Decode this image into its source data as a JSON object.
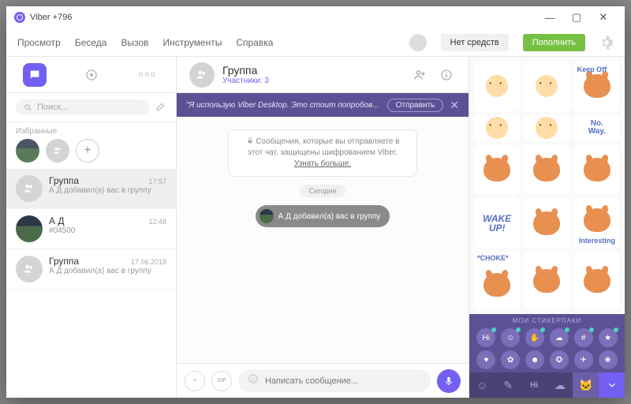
{
  "titlebar": {
    "title": "Viber +796"
  },
  "menubar": {
    "view": "Просмотр",
    "convo": "Беседа",
    "call": "Вызов",
    "tools": "Инструменты",
    "help": "Справка",
    "balance": "Нет средств",
    "topup": "Пополнить"
  },
  "sidebar": {
    "search_placeholder": "Поиск...",
    "favorites_label": "Избранные",
    "chats": [
      {
        "name": "Группа",
        "time": "17:57",
        "snippet": "А Д добавил(а) вас в группу"
      },
      {
        "name": "А Д",
        "time": "12:48",
        "snippet": "#04500"
      },
      {
        "name": "Группа",
        "time": "17.06.2018",
        "snippet": "А Д добавил(а) вас в группу"
      }
    ]
  },
  "chat": {
    "title": "Группа",
    "participants": "Участники: 3",
    "promo_text": "\"Я использую Viber Desktop. Это стоит попробов...",
    "promo_send": "Отправить",
    "encryption_text": "Сообщения, которые вы отправляете в этот чат, защищены шифрованием Viber.",
    "encryption_learn": "Узнать больше.",
    "date_label": "Сегодня",
    "system_msg": "А Д добавил(а) вас в группу",
    "composer_placeholder": "Написать сообщение..."
  },
  "stickers": {
    "captions": {
      "keepoff": "Keep Off",
      "noway": "No. Way.",
      "wake": "WAKE UP!",
      "interesting": "Interesting",
      "choke": "*CHOKE*"
    },
    "packs_title": "МОИ СТИКЕРПАКИ",
    "pack_hi": "Hi"
  }
}
